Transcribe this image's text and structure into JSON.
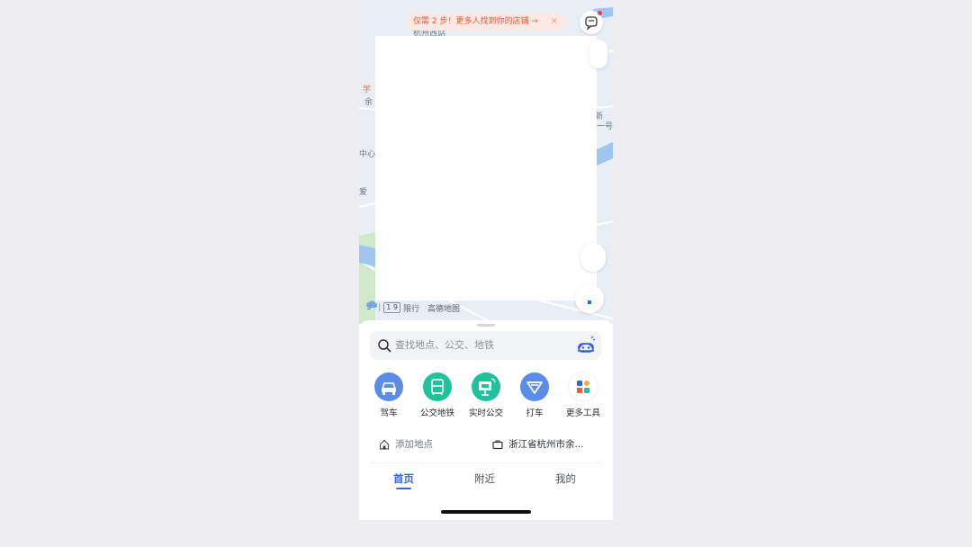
{
  "banner": {
    "text": "仅需 2 步！更多人找到你的店铺 →",
    "close": "×"
  },
  "map": {
    "weather": {
      "temp": "9°",
      "traffic_limit": "1 9",
      "limit_label": "限行",
      "map_brand": "高德地图"
    },
    "labels": [
      "杭州西站",
      "余",
      "中心",
      "新",
      "一号",
      "爱",
      "学"
    ]
  },
  "search": {
    "placeholder": "查找地点、公交、地铁"
  },
  "tools": [
    {
      "label": "驾车",
      "icon": "car-icon",
      "color": "#5b8de8"
    },
    {
      "label": "公交地铁",
      "icon": "bus-icon",
      "color": "#1fc29a"
    },
    {
      "label": "实时公交",
      "icon": "realtime-bus-icon",
      "color": "#1fc29a"
    },
    {
      "label": "打车",
      "icon": "taxi-icon",
      "color": "#5b8de8"
    },
    {
      "label": "更多工具",
      "icon": "grid-icon",
      "color": "#ffffff"
    }
  ],
  "places": {
    "home": "添加地点",
    "work": "浙江省杭州市余..."
  },
  "tabs": [
    {
      "label": "首页",
      "active": true
    },
    {
      "label": "附近",
      "active": false
    },
    {
      "label": "我的",
      "active": false
    }
  ]
}
